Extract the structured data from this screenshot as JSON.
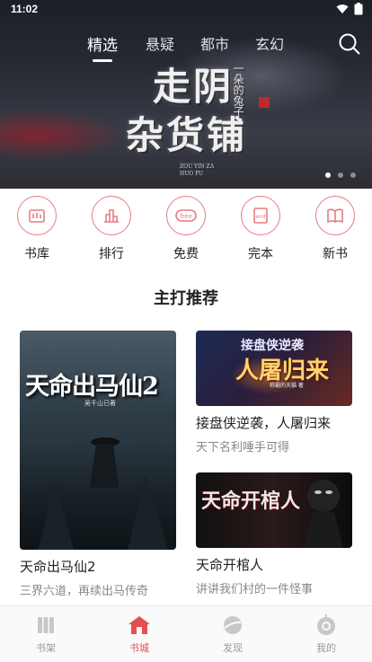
{
  "status_bar": {
    "time": "11:02",
    "icons": [
      "wifi-icon",
      "battery-icon"
    ]
  },
  "top_tabs": [
    {
      "label": "精选",
      "active": true
    },
    {
      "label": "悬疑",
      "active": false
    },
    {
      "label": "都市",
      "active": false
    },
    {
      "label": "玄幻",
      "active": false
    }
  ],
  "banner": {
    "cover_title_line1": "走阴",
    "cover_title_line2": "杂货铺",
    "author": "一朵的兔子",
    "pinyin": "ZOU YIN ZA HUO PU",
    "slides": 3,
    "active_slide": 0
  },
  "categories": [
    {
      "label": "书库",
      "icon": "library-icon"
    },
    {
      "label": "排行",
      "icon": "ranking-icon"
    },
    {
      "label": "免费",
      "icon": "free-icon"
    },
    {
      "label": "完本",
      "icon": "completed-icon"
    },
    {
      "label": "新书",
      "icon": "new-book-icon"
    }
  ],
  "section_title": "主打推荐",
  "books": [
    {
      "title": "天命出马仙2",
      "desc": "三界六道，再续出马传奇",
      "cover_text": "天命出马仙2",
      "cover_author": "吴千山已著"
    },
    {
      "title": "接盘侠逆袭，人屠归来",
      "desc": "天下名利唾手可得",
      "cover_text_top": "接盘侠逆袭",
      "cover_text_main": "人屠归来",
      "cover_author": "称霸的天猫 著"
    },
    {
      "title": "天命开棺人",
      "desc": "讲讲我们村的一件怪事",
      "cover_text": "天命开棺人"
    }
  ],
  "bottom_nav": [
    {
      "label": "书架",
      "icon": "bookshelf-icon",
      "active": false
    },
    {
      "label": "书城",
      "icon": "bookstore-icon",
      "active": true
    },
    {
      "label": "发现",
      "icon": "discover-icon",
      "active": false
    },
    {
      "label": "我的",
      "icon": "profile-icon",
      "active": false
    }
  ],
  "colors": {
    "accent": "#e2504f",
    "category_ring": "#e67c80"
  }
}
